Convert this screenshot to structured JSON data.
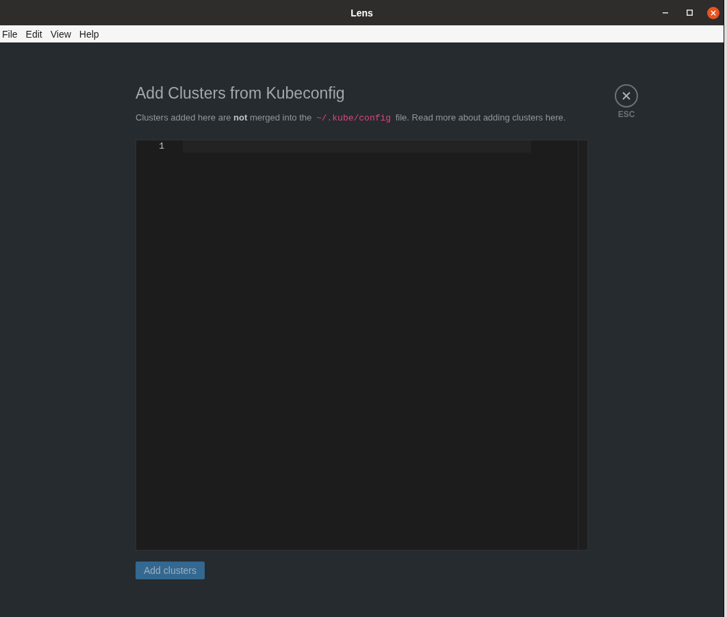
{
  "window": {
    "title": "Lens"
  },
  "menu_bar": {
    "items": [
      "File",
      "Edit",
      "View",
      "Help"
    ]
  },
  "dialog": {
    "title": "Add Clusters from Kubeconfig",
    "description": {
      "before": "Clusters added here are **not** merged into the",
      "path": "~/.kube/config",
      "after": "file. Read more about adding clusters here."
    },
    "close": {
      "label": "ESC"
    },
    "editor": {
      "lines": [
        {
          "number": "1",
          "current": true
        }
      ]
    },
    "submit": {
      "label": "Add clusters",
      "disabled": true
    }
  }
}
